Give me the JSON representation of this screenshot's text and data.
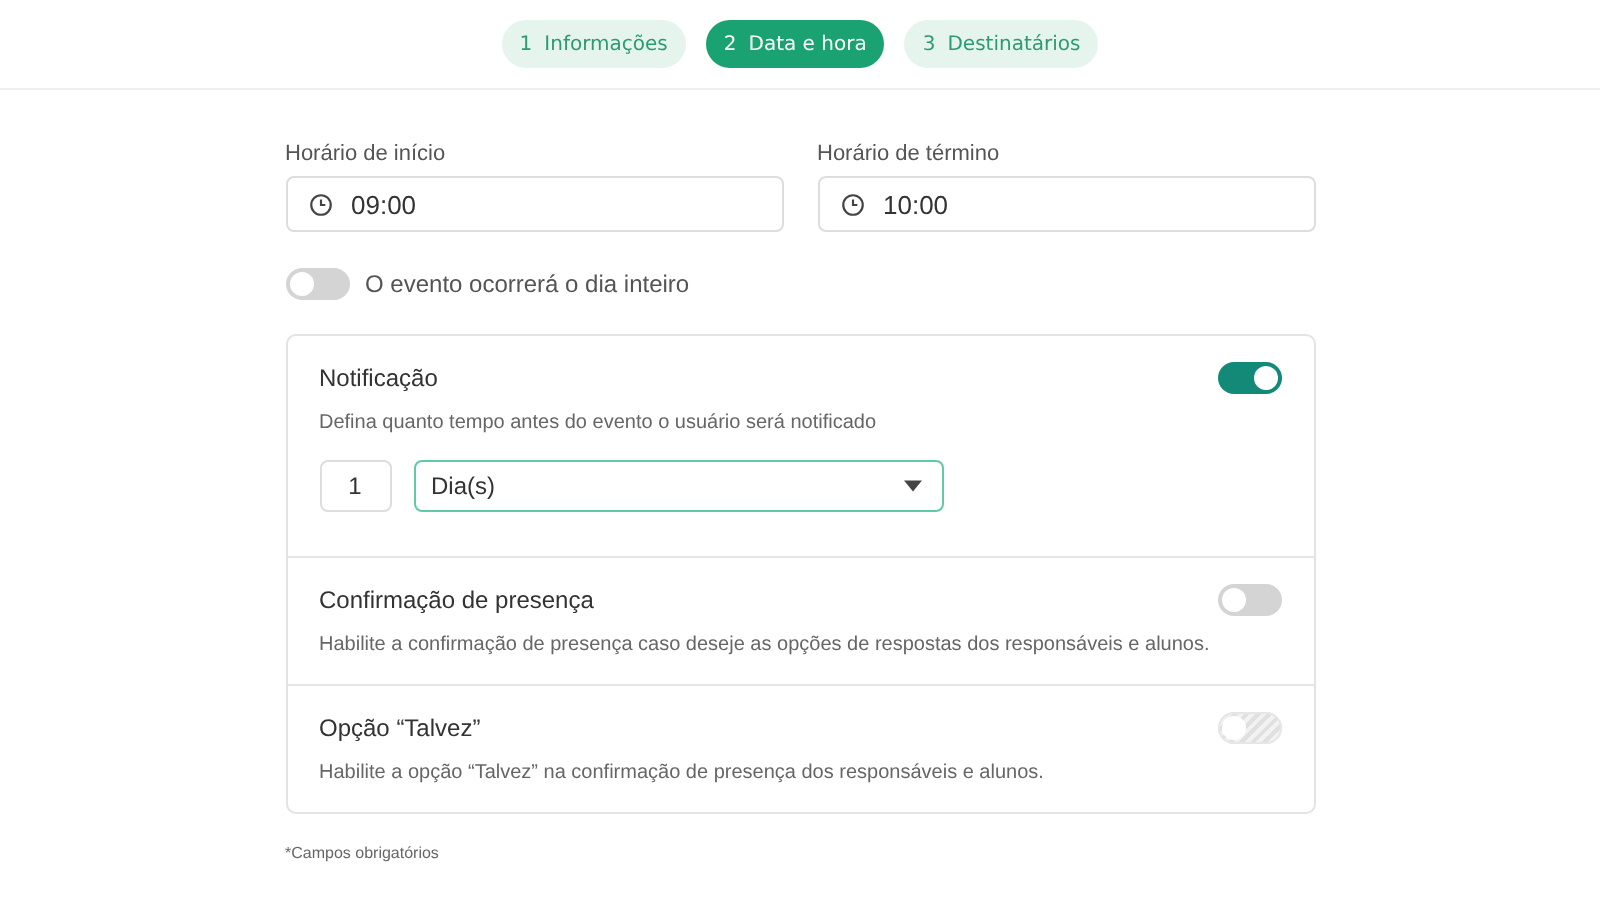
{
  "steps": [
    {
      "number": "1",
      "label": "Informações",
      "selected": false
    },
    {
      "number": "2",
      "label": "Data e hora",
      "selected": true
    },
    {
      "number": "3",
      "label": "Destinatários",
      "selected": false
    }
  ],
  "time_fields": [
    {
      "label": "Horário de início",
      "value": "09:00"
    },
    {
      "label": "Horário de término",
      "value": "10:00"
    }
  ],
  "all_day": {
    "label": "O evento ocorrerá o dia inteiro",
    "on": false
  },
  "settings": [
    {
      "kind": "notification",
      "title": "Notificação",
      "description": "Defina quanto tempo antes do evento o usuário será notificado",
      "on": true,
      "disabled": false,
      "amount": "1",
      "unit": "Dia(s)"
    },
    {
      "kind": "plain",
      "title": "Confirmação de presença",
      "description": "Habilite a confirmação de presença caso deseje as opções de respostas dos responsáveis e alunos.",
      "on": false,
      "disabled": false
    },
    {
      "kind": "plain",
      "title": "Opção “Talvez”",
      "description": "Habilite a opção “Talvez” na confirmação de presença dos responsáveis e alunos.",
      "on": false,
      "disabled": true
    }
  ],
  "footnote": "*Campos obrigatórios"
}
